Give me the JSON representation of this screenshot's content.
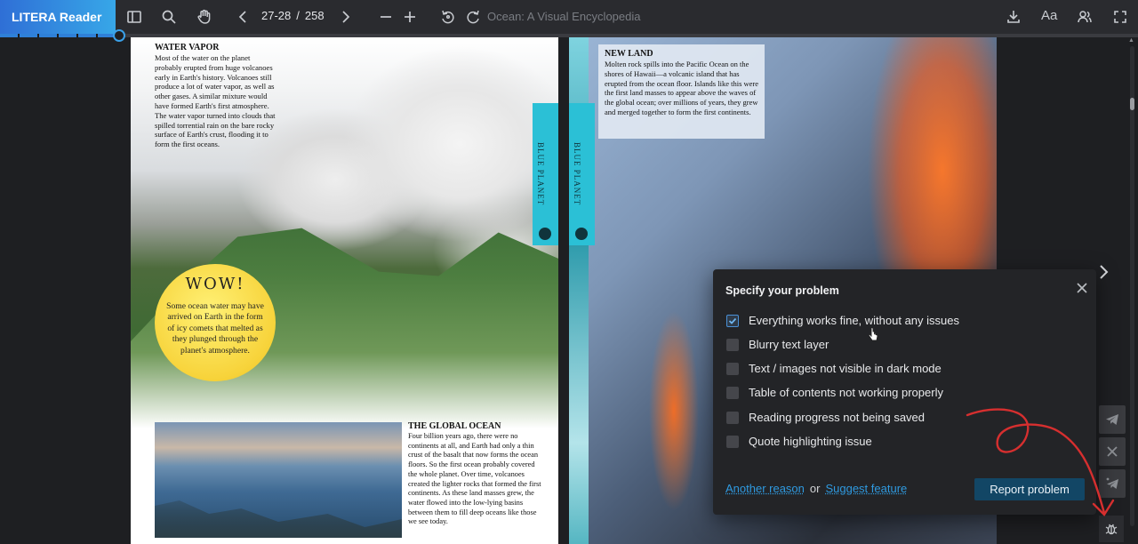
{
  "app": {
    "logo_text": "LITERA Reader",
    "book_title": "Ocean: A Visual Encyclopedia"
  },
  "toolbar": {
    "page_current": "27-28",
    "page_separator": "/",
    "page_total": "258",
    "font_label": "Aa",
    "icons": [
      "sidebar-icon",
      "search-icon",
      "hand-icon",
      "prev-page-icon",
      "next-page-icon",
      "zoom-out-icon",
      "zoom-in-icon",
      "undo-icon",
      "redo-icon",
      "download-icon",
      "font-icon",
      "users-icon",
      "fullscreen-icon"
    ]
  },
  "reading_progress": 0.105,
  "book": {
    "left_page": {
      "water_vapor_title": "WATER VAPOR",
      "water_vapor_text": "Most of the water on the planet probably erupted from huge volcanoes early in Earth's history. Volcanoes still produce a lot of water vapor, as well as other gases. A similar mixture would have formed Earth's first atmosphere. The water vapor turned into clouds that spilled torrential rain on the bare rocky surface of Earth's crust, flooding it to form the first oceans.",
      "wow_title": "WOW!",
      "wow_text": "Some ocean water may have arrived on Earth in the form of icy comets that melted as they plunged through the planet's atmosphere.",
      "global_ocean_title": "THE GLOBAL OCEAN",
      "global_ocean_text": "Four billion years ago, there were no continents at all, and Earth had only a thin crust of the basalt that now forms the ocean floors. So the first ocean probably covered the whole planet. Over time, volcanoes created the lighter rocks that formed the first continents. As these land masses grew, the water flowed into the low-lying basins between them to fill deep oceans like those we see today.",
      "tab_label": "BLUE PLANET"
    },
    "right_page": {
      "new_land_title": "NEW LAND",
      "new_land_text": "Molten rock spills into the Pacific Ocean on the shores of Hawaii—a volcanic island that has erupted from the ocean floor. Islands like this were the first land masses to appear above the waves of the global ocean; over millions of years, they grew and merged together to form the first continents.",
      "tab_label": "BLUE PLANET"
    }
  },
  "dialog": {
    "title": "Specify your problem",
    "options": [
      {
        "label": "Everything works fine, without any issues",
        "checked": true
      },
      {
        "label": "Blurry text layer",
        "checked": false
      },
      {
        "label": "Text / images not visible in dark mode",
        "checked": false
      },
      {
        "label": "Table of contents not working properly",
        "checked": false
      },
      {
        "label": "Reading progress not being saved",
        "checked": false
      },
      {
        "label": "Quote highlighting issue",
        "checked": false
      }
    ],
    "another_reason": "Another reason",
    "or_text": "or",
    "suggest_feature": "Suggest feature",
    "report_button": "Report problem"
  },
  "side_buttons": [
    "telegram-icon",
    "x-icon",
    "telegram-star-icon",
    "bug-icon"
  ],
  "colors": {
    "accent": "#2f9ae0",
    "report_button": "#124665",
    "logo_gradient_start": "#2f6fd6",
    "logo_gradient_end": "#37a7e8",
    "annotation_red": "#d62f2f"
  }
}
